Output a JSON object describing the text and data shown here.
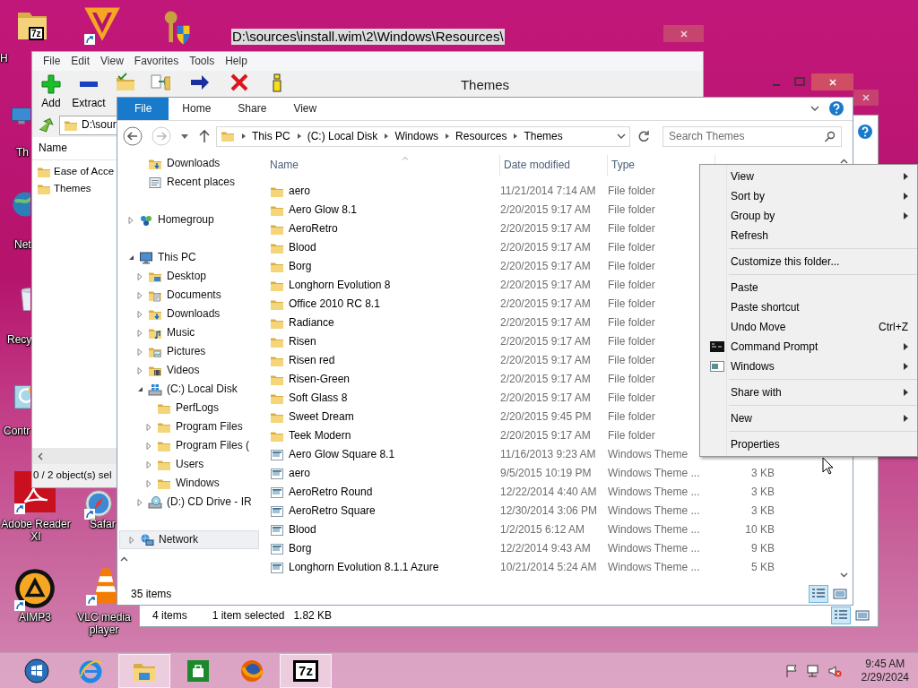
{
  "desktop_icons": [
    {
      "label": "H",
      "badge": "7z",
      "shortcut": false
    },
    {
      "shortcut": true
    },
    {
      "shortcut": false
    },
    {
      "label": "Th",
      "shortcut": false
    },
    {
      "label": "Net",
      "shortcut": false
    },
    {
      "label": "Recy",
      "shortcut": false
    },
    {
      "label": "Contr",
      "shortcut": false
    },
    {
      "label": "Adobe Reader XI",
      "shortcut": true
    },
    {
      "label": "Safar",
      "shortcut": true
    },
    {
      "label": "AIMP3",
      "shortcut": true
    },
    {
      "label": "VLC media player",
      "shortcut": true
    }
  ],
  "archive_window": {
    "title": "D:\\sources\\install.wim\\2\\Windows\\Resources\\",
    "menu": [
      "File",
      "Edit",
      "View",
      "Favorites",
      "Tools",
      "Help"
    ],
    "toolbar": [
      {
        "label": "Add"
      },
      {
        "label": "Extract"
      }
    ],
    "address": "D:\\sour",
    "column": "Name",
    "items": [
      "Ease of Acce",
      "Themes"
    ],
    "status": "0 / 2 object(s) sel"
  },
  "back_window": {
    "status_count": "4 items",
    "status_selection": "1 item selected",
    "status_size": "1.82 KB",
    "view_buttons": [
      {
        "selected": true
      },
      {
        "selected": false
      }
    ]
  },
  "explorer": {
    "title": "Themes",
    "ribbon_tabs": [
      {
        "label": "File",
        "kind": "file"
      },
      {
        "label": "Home",
        "kind": "tab"
      },
      {
        "label": "Share",
        "kind": "tab"
      },
      {
        "label": "View",
        "kind": "tab"
      }
    ],
    "breadcrumb": [
      "This PC",
      "(C:) Local Disk",
      "Windows",
      "Resources",
      "Themes"
    ],
    "search": {
      "placeholder": "Search Themes"
    },
    "nav": [
      {
        "kind": "favorites",
        "items": [
          {
            "label": "Downloads",
            "kind": "downloads",
            "selected": false
          },
          {
            "label": "Recent places",
            "kind": "recent",
            "selected": false
          }
        ]
      },
      {
        "kind": "root",
        "items": [
          {
            "label": "Homegroup",
            "kind": "homegroup",
            "expanded": false,
            "selected": false
          }
        ]
      },
      {
        "kind": "root",
        "items": [
          {
            "label": "This PC",
            "kind": "pc",
            "expanded": true,
            "selected": false,
            "children": [
              {
                "label": "Desktop",
                "kind": "desktop",
                "expanded": false,
                "selected": false
              },
              {
                "label": "Documents",
                "kind": "documents",
                "expanded": false,
                "selected": false
              },
              {
                "label": "Downloads",
                "kind": "downloads",
                "expanded": false,
                "selected": false
              },
              {
                "label": "Music",
                "kind": "music",
                "expanded": false,
                "selected": false
              },
              {
                "label": "Pictures",
                "kind": "pictures",
                "expanded": false,
                "selected": false
              },
              {
                "label": "Videos",
                "kind": "videos",
                "expanded": false,
                "selected": false
              },
              {
                "label": "(C:) Local Disk",
                "kind": "drive",
                "expanded": true,
                "selected": false,
                "children": [
                  {
                    "label": "PerfLogs",
                    "kind": "folder",
                    "selected": false
                  },
                  {
                    "label": "Program Files",
                    "kind": "folder",
                    "expanded": false,
                    "selected": false
                  },
                  {
                    "label": "Program Files (",
                    "kind": "folder",
                    "expanded": false,
                    "selected": false
                  },
                  {
                    "label": "Users",
                    "kind": "folder",
                    "expanded": false,
                    "selected": false
                  },
                  {
                    "label": "Windows",
                    "kind": "folder",
                    "expanded": false,
                    "selected": false
                  }
                ]
              },
              {
                "label": "(D:) CD Drive - IR",
                "kind": "cd",
                "expanded": false,
                "selected": false
              }
            ]
          }
        ]
      },
      {
        "kind": "root",
        "items": [
          {
            "label": "Network",
            "kind": "network",
            "expanded": false,
            "selected": true
          }
        ]
      }
    ],
    "columns": [
      "Name",
      "Date modified",
      "Type"
    ],
    "files": [
      {
        "kind": "folder",
        "name": "aero",
        "date": "11/21/2014 7:14 AM",
        "type": "File folder"
      },
      {
        "kind": "folder",
        "name": "Aero Glow 8.1",
        "date": "2/20/2015 9:17 AM",
        "type": "File folder"
      },
      {
        "kind": "folder",
        "name": "AeroRetro",
        "date": "2/20/2015 9:17 AM",
        "type": "File folder"
      },
      {
        "kind": "folder",
        "name": "Blood",
        "date": "2/20/2015 9:17 AM",
        "type": "File folder"
      },
      {
        "kind": "folder",
        "name": "Borg",
        "date": "2/20/2015 9:17 AM",
        "type": "File folder"
      },
      {
        "kind": "folder",
        "name": "Longhorn Evolution 8",
        "date": "2/20/2015 9:17 AM",
        "type": "File folder"
      },
      {
        "kind": "folder",
        "name": "Office 2010 RC 8.1",
        "date": "2/20/2015 9:17 AM",
        "type": "File folder"
      },
      {
        "kind": "folder",
        "name": "Radiance",
        "date": "2/20/2015 9:17 AM",
        "type": "File folder"
      },
      {
        "kind": "folder",
        "name": "Risen",
        "date": "2/20/2015 9:17 AM",
        "type": "File folder"
      },
      {
        "kind": "folder",
        "name": "Risen red",
        "date": "2/20/2015 9:17 AM",
        "type": "File folder"
      },
      {
        "kind": "folder",
        "name": "Risen-Green",
        "date": "2/20/2015 9:17 AM",
        "type": "File folder"
      },
      {
        "kind": "folder",
        "name": "Soft Glass 8",
        "date": "2/20/2015 9:17 AM",
        "type": "File folder"
      },
      {
        "kind": "folder",
        "name": "Sweet Dream",
        "date": "2/20/2015 9:45 PM",
        "type": "File folder"
      },
      {
        "kind": "folder",
        "name": "Teek Modern",
        "date": "2/20/2015 9:17 AM",
        "type": "File folder"
      },
      {
        "kind": "theme",
        "name": "Aero Glow Square 8.1",
        "date": "11/16/2013 9:23 AM",
        "type": "Windows Theme"
      },
      {
        "kind": "theme",
        "name": "aero",
        "date": "9/5/2015 10:19 PM",
        "type": "Windows Theme ...",
        "size": "3 KB"
      },
      {
        "kind": "theme",
        "name": "AeroRetro Round",
        "date": "12/22/2014 4:40 AM",
        "type": "Windows Theme ...",
        "size": "3 KB"
      },
      {
        "kind": "theme",
        "name": "AeroRetro Square",
        "date": "12/30/2014 3:06 PM",
        "type": "Windows Theme ...",
        "size": "3 KB"
      },
      {
        "kind": "theme",
        "name": "Blood",
        "date": "1/2/2015 6:12 AM",
        "type": "Windows Theme ...",
        "size": "10 KB"
      },
      {
        "kind": "theme",
        "name": "Borg",
        "date": "12/2/2014 9:43 AM",
        "type": "Windows Theme ...",
        "size": "9 KB"
      },
      {
        "kind": "theme",
        "name": "Longhorn Evolution 8.1.1 Azure",
        "date": "10/21/2014 5:24 AM",
        "type": "Windows Theme ...",
        "size": "5 KB"
      }
    ],
    "status": "35 items",
    "view_buttons": [
      {
        "selected": true
      },
      {
        "selected": false
      }
    ]
  },
  "context_menu": [
    {
      "kind": "item",
      "label": "View",
      "submenu": true
    },
    {
      "kind": "item",
      "label": "Sort by",
      "submenu": true
    },
    {
      "kind": "item",
      "label": "Group by",
      "submenu": true
    },
    {
      "kind": "item",
      "label": "Refresh",
      "submenu": false
    },
    {
      "kind": "separator"
    },
    {
      "kind": "item",
      "label": "Customize this folder...",
      "submenu": false
    },
    {
      "kind": "separator"
    },
    {
      "kind": "item",
      "label": "Paste",
      "submenu": false
    },
    {
      "kind": "item",
      "label": "Paste shortcut",
      "submenu": false
    },
    {
      "kind": "item",
      "label": "Undo Move",
      "shortcut": "Ctrl+Z",
      "submenu": false
    },
    {
      "kind": "item",
      "label": "Command Prompt",
      "submenu": true
    },
    {
      "kind": "item",
      "label": "Windows",
      "submenu": true
    },
    {
      "kind": "separator"
    },
    {
      "kind": "item",
      "label": "Share with",
      "submenu": true
    },
    {
      "kind": "separator"
    },
    {
      "kind": "item",
      "label": "New",
      "submenu": true
    },
    {
      "kind": "separator"
    },
    {
      "kind": "item",
      "label": "Properties",
      "submenu": false
    }
  ],
  "taskbar": {
    "apps": [
      {
        "running": false
      },
      {
        "running": false
      },
      {
        "running": true
      },
      {
        "running": false
      },
      {
        "running": false
      },
      {
        "running": true,
        "label": "7z"
      }
    ],
    "time": "9:45 AM",
    "date": "2/29/2024"
  }
}
